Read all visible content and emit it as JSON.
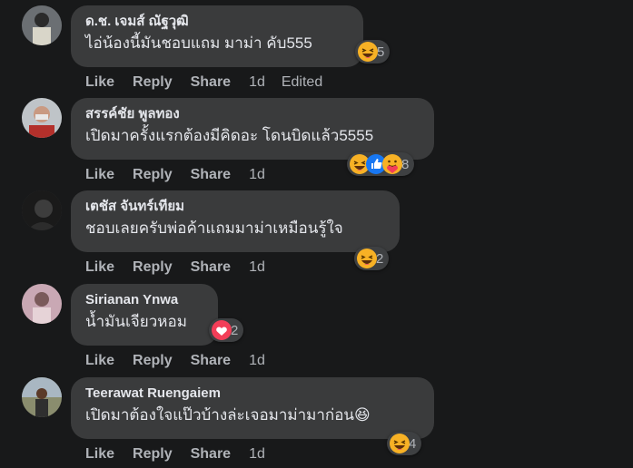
{
  "comments": [
    {
      "author": "ด.ช. เจมส์ ณัฐวุฒิ",
      "text": "ไอ่น้องนี้มันชอบแถม มาม่า คับ555",
      "reactions": [
        "haha"
      ],
      "reaction_count": "5",
      "like": "Like",
      "reply": "Reply",
      "share": "Share",
      "time": "1d",
      "edited": "Edited"
    },
    {
      "author": "สรรค์ชัย พูลทอง",
      "text": "เปิดมาครั้งแรกต้องมีคิดอะ โดนบิดแล้ว5555",
      "reactions": [
        "haha",
        "like",
        "care"
      ],
      "reaction_count": "8",
      "like": "Like",
      "reply": "Reply",
      "share": "Share",
      "time": "1d"
    },
    {
      "author": "เตชัส จันทร์เทียม",
      "text": "ชอบเลยครับพ่อค้าแถมมาม่าเหมือนรู้ใจ",
      "reactions": [
        "haha"
      ],
      "reaction_count": "2",
      "like": "Like",
      "reply": "Reply",
      "share": "Share",
      "time": "1d"
    },
    {
      "author": "Sirianan Ynwa",
      "text": "น้ำมันเจียวหอม",
      "reactions": [
        "love"
      ],
      "reaction_count": "2",
      "like": "Like",
      "reply": "Reply",
      "share": "Share",
      "time": "1d"
    },
    {
      "author": "Teerawat Ruengaiem",
      "text": "เปิดมาต้องใจแป๊วบ้างล่ะเจอมาม่ามาก่อน😆",
      "reactions": [
        "haha"
      ],
      "reaction_count": "4",
      "like": "Like",
      "reply": "Reply",
      "share": "Share",
      "time": "1d"
    }
  ]
}
